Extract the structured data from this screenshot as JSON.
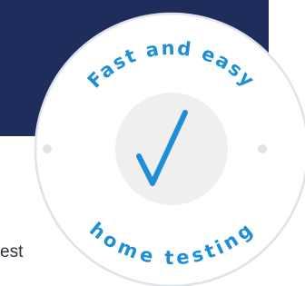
{
  "badge": {
    "top_text": "Fast and easy",
    "bottom_text": "home testing",
    "icon": "checkmark-icon",
    "text_color": "#1e8fd6",
    "check_color": "#1e8fd6",
    "ring_color": "#dfe3ea",
    "inner_circle_color": "#efefef"
  },
  "banner": {
    "color": "#1f2d5c"
  },
  "page": {
    "partial_text": "est"
  }
}
